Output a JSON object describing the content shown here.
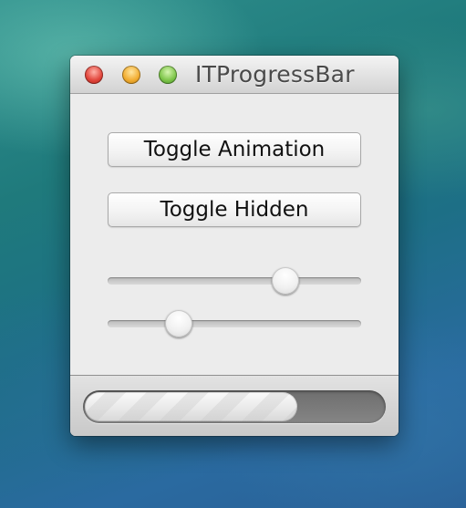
{
  "window": {
    "title": "ITProgressBar"
  },
  "controls": {
    "toggle_animation_label": "Toggle Animation",
    "toggle_hidden_label": "Toggle Hidden"
  },
  "sliders": [
    {
      "name": "slider-1",
      "value": 0.7
    },
    {
      "name": "slider-2",
      "value": 0.28
    }
  ],
  "progress": {
    "value": 0.71,
    "animated": true
  },
  "icons": {
    "close": "close-icon",
    "minimize": "minimize-icon",
    "zoom": "zoom-icon"
  },
  "colors": {
    "close": "#e2463c",
    "minimize": "#f2ad32",
    "zoom": "#7fc64b",
    "window_bg": "#ececec",
    "progress_track": "#777777",
    "progress_fill": "#f0f0f0"
  }
}
